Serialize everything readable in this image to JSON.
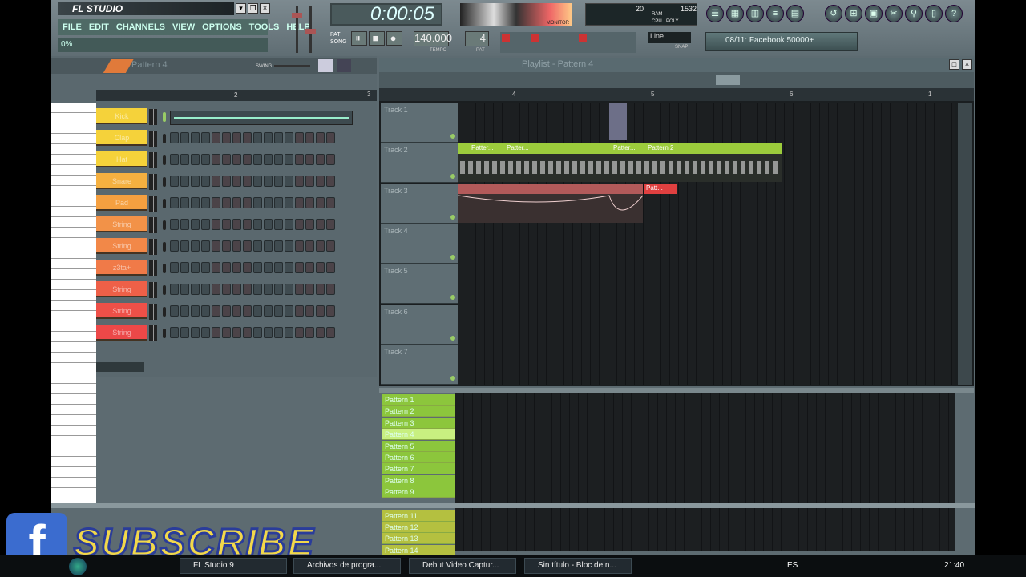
{
  "app": {
    "title": "FL STUDIO",
    "menu": [
      "FILE",
      "EDIT",
      "CHANNELS",
      "VIEW",
      "OPTIONS",
      "TOOLS",
      "HELP"
    ],
    "hint": "0%"
  },
  "transport": {
    "time": "0:00:05",
    "tempo": "140.000",
    "pattern_num": "4",
    "pat_label": "PAT",
    "song_label": "SONG",
    "tempo_label": "TEMPO",
    "pat2_label": "PAT",
    "snap": "Line",
    "snap_label": "SNAP",
    "monitor_label": "MONITOR"
  },
  "cpu": {
    "value": "20",
    "ram": "1532",
    "ram_label": "RAM",
    "cpu_label": "CPU",
    "poly_label": "POLY"
  },
  "news": "08/11: Facebook 50000+",
  "channel_window": {
    "pattern": "Pattern 4",
    "swing_label": "SWING",
    "channels": [
      "Kick",
      "Clap",
      "Hat",
      "Snare",
      "Pad",
      "String",
      "String",
      "z3ta+",
      "String",
      "String",
      "String"
    ]
  },
  "playlist": {
    "title": "Playlist - Pattern 4",
    "ruler": [
      "3",
      "4",
      "5",
      "6",
      "1"
    ],
    "ruler_left": "2",
    "tracks": [
      "Track 1",
      "Track 2",
      "Track 3",
      "Track 4",
      "Track 5",
      "Track 6",
      "Track 7"
    ],
    "clips": [
      "Patter...",
      "Patter...",
      "Patter...",
      "Pattern 2",
      "Patt..."
    ],
    "patterns": [
      "Pattern 1",
      "Pattern 2",
      "Pattern 3",
      "Pattern 4",
      "Pattern 5",
      "Pattern 6",
      "Pattern 7",
      "Pattern 8",
      "Pattern 9",
      "Pattern 11",
      "Pattern 12",
      "Pattern 13",
      "Pattern 14"
    ]
  },
  "overlay": {
    "subscribe": "SUBSCRIBE"
  },
  "taskbar": {
    "items": [
      "FL Studio 9",
      "Archivos de progra...",
      "Debut Video Captur...",
      "Sin título - Bloc de n..."
    ],
    "lang": "ES",
    "clock": "21:40"
  },
  "colors": {
    "accent": "#9ccc3c",
    "red": "#e04040"
  }
}
